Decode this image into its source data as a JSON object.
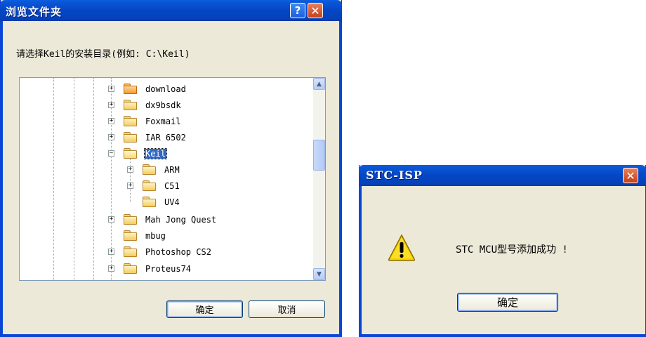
{
  "browse_dialog": {
    "title": "浏览文件夹",
    "help_glyph": "?",
    "close_glyph": "✕",
    "prompt": "请选择Keil的安装目录(例如: C:\\Keil)",
    "tree_items": [
      {
        "label": "download",
        "expander": "+"
      },
      {
        "label": "dx9bsdk",
        "expander": "+"
      },
      {
        "label": "Foxmail",
        "expander": "+"
      },
      {
        "label": "IAR 6502",
        "expander": "+"
      },
      {
        "label": "Keil",
        "expander": "−",
        "selected": true
      },
      {
        "label": "ARM",
        "expander": "+"
      },
      {
        "label": "C51",
        "expander": "+"
      },
      {
        "label": "UV4",
        "expander": ""
      },
      {
        "label": "Mah Jong Quest",
        "expander": "+"
      },
      {
        "label": "mbug",
        "expander": ""
      },
      {
        "label": "Photoshop CS2",
        "expander": "+"
      },
      {
        "label": "Proteus74",
        "expander": "+"
      }
    ],
    "scroll_up": "▲",
    "scroll_down": "▼",
    "ok_label": "确定",
    "cancel_label": "取消"
  },
  "stc_dialog": {
    "title": "STC-ISP",
    "close_glyph": "✕",
    "icon": "warning-icon",
    "message": "STC MCU型号添加成功 !",
    "ok_label": "确定"
  },
  "colors": {
    "titlebar": "#0446c5",
    "selection": "#316ac5",
    "dialog_face": "#ece9d8"
  }
}
